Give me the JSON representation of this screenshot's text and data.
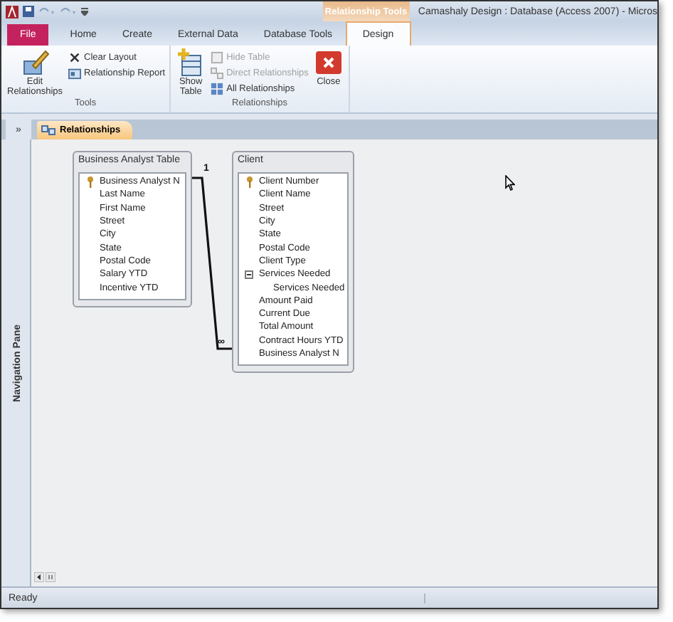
{
  "window": {
    "title": "Camashaly Design : Database (Access 2007) - Micros"
  },
  "context_tab_group": "Relationship Tools",
  "ribbon_tabs": [
    {
      "label": "File",
      "kind": "file",
      "selected": false
    },
    {
      "label": "Home",
      "kind": "normal",
      "selected": false
    },
    {
      "label": "Create",
      "kind": "normal",
      "selected": false
    },
    {
      "label": "External Data",
      "kind": "normal",
      "selected": false
    },
    {
      "label": "Database Tools",
      "kind": "normal",
      "selected": false
    },
    {
      "label": "Design",
      "kind": "context",
      "selected": true
    }
  ],
  "ribbon_groups": [
    {
      "label": "Tools",
      "commands": [
        {
          "label": "Edit Relationships",
          "kind": "large",
          "disabled": false
        },
        {
          "label": "Clear Layout",
          "kind": "small",
          "disabled": false
        },
        {
          "label": "Relationship Report",
          "kind": "small",
          "disabled": false
        }
      ]
    },
    {
      "label": "Relationships",
      "commands": [
        {
          "label": "Show Table",
          "kind": "large",
          "disabled": false
        },
        {
          "label": "Hide Table",
          "kind": "small",
          "disabled": true
        },
        {
          "label": "Direct Relationships",
          "kind": "small",
          "disabled": true
        },
        {
          "label": "All Relationships",
          "kind": "small",
          "disabled": false
        },
        {
          "label": "Close",
          "kind": "large",
          "disabled": false
        }
      ]
    }
  ],
  "nav_toggle": "»",
  "document_tabs": [
    {
      "label": "Relationships",
      "selected": true
    }
  ],
  "navigation_pane": {
    "label": "Navigation Pane"
  },
  "tables": [
    {
      "title": "Business Analyst Table",
      "fields": [
        {
          "name": "Business Analyst N",
          "primary_key": true
        },
        {
          "name": "Last Name",
          "primary_key": false
        },
        {
          "name": "First Name",
          "primary_key": false
        },
        {
          "name": "Street",
          "primary_key": false
        },
        {
          "name": "City",
          "primary_key": false
        },
        {
          "name": "State",
          "primary_key": false
        },
        {
          "name": "Postal Code",
          "primary_key": false
        },
        {
          "name": "Salary YTD",
          "primary_key": false
        },
        {
          "name": "Incentive YTD",
          "primary_key": false
        }
      ]
    },
    {
      "title": "Client",
      "fields": [
        {
          "name": "Client Number",
          "primary_key": true
        },
        {
          "name": "Client Name",
          "primary_key": false
        },
        {
          "name": "Street",
          "primary_key": false
        },
        {
          "name": "City",
          "primary_key": false
        },
        {
          "name": "State",
          "primary_key": false
        },
        {
          "name": "Postal Code",
          "primary_key": false
        },
        {
          "name": "Client Type",
          "primary_key": false
        },
        {
          "name": "Services Needed",
          "primary_key": false,
          "expanded": true,
          "children": [
            {
              "name": "Services Needed",
              "primary_key": false
            }
          ]
        },
        {
          "name": "Amount Paid",
          "primary_key": false
        },
        {
          "name": "Current Due",
          "primary_key": false
        },
        {
          "name": "Total Amount",
          "primary_key": false
        },
        {
          "name": "Contract Hours YTD",
          "primary_key": false
        },
        {
          "name": "Business Analyst N",
          "primary_key": false
        }
      ]
    }
  ],
  "relationship": {
    "one_label": "1",
    "many_label": "∞"
  },
  "status_bar": {
    "text": "Ready"
  }
}
